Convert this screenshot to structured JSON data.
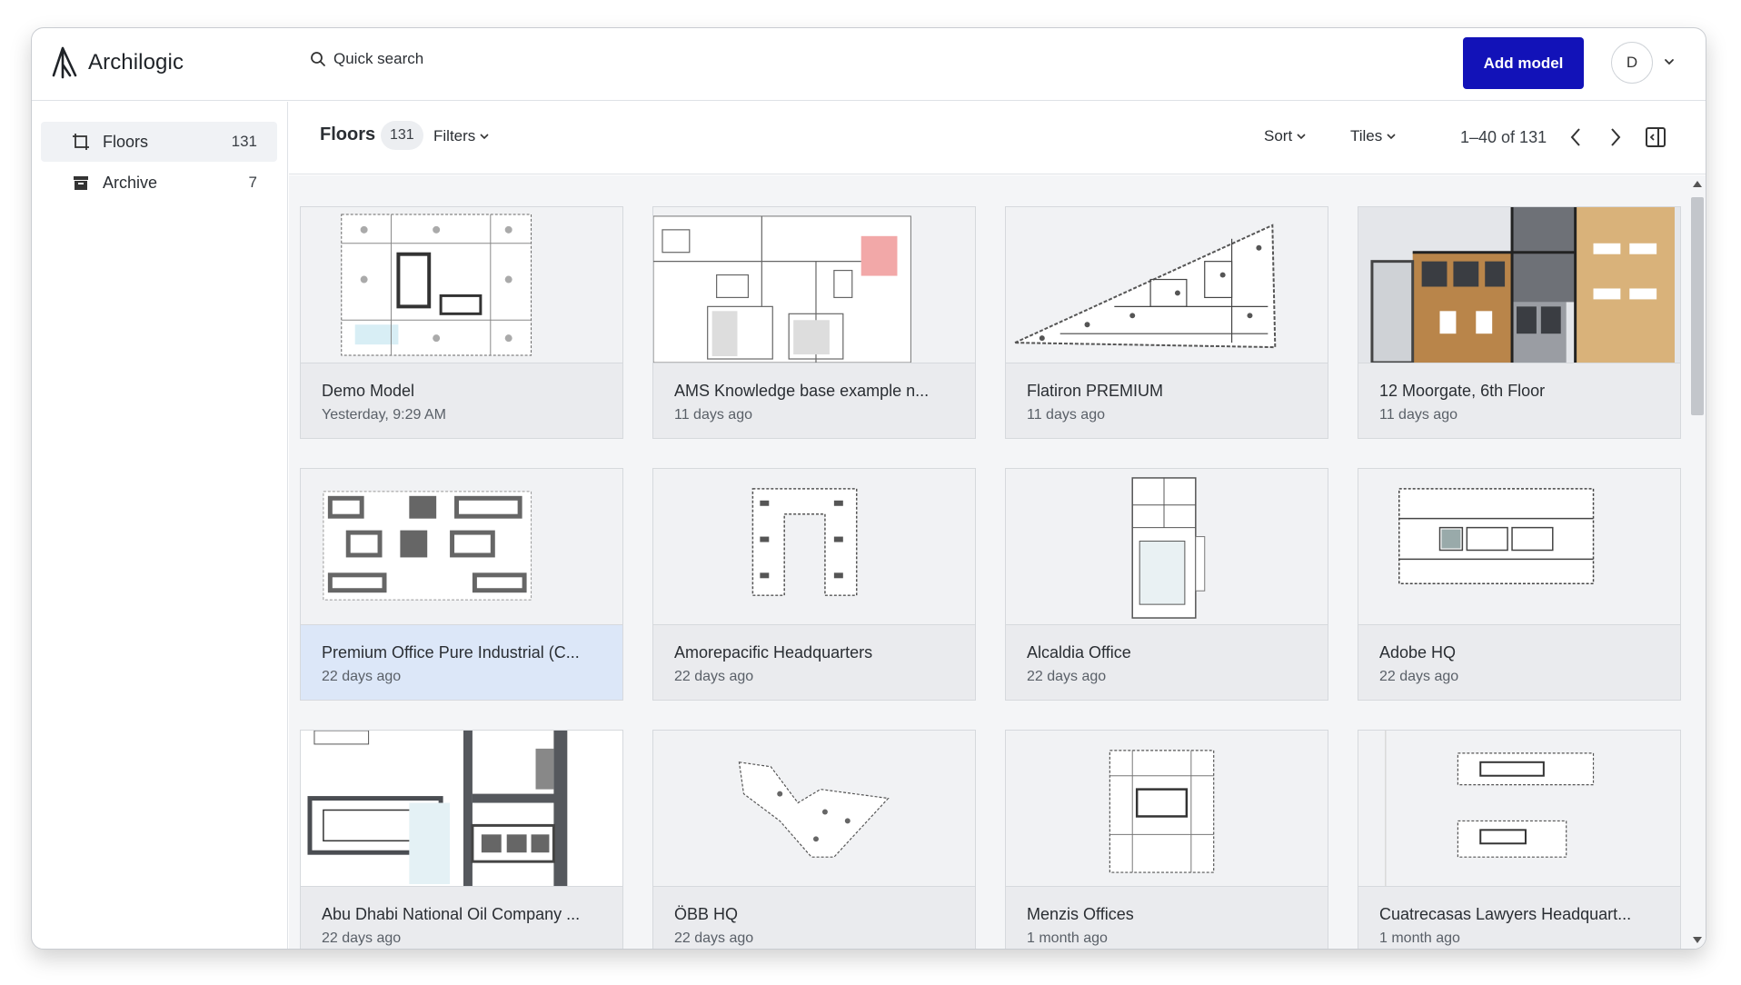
{
  "app": {
    "name": "Archilogic"
  },
  "search": {
    "placeholder": "Quick search"
  },
  "header": {
    "add_model_label": "Add model",
    "avatar_initial": "D"
  },
  "sidebar": {
    "items": [
      {
        "label": "Floors",
        "count": "131",
        "icon": "floor-icon",
        "active": true
      },
      {
        "label": "Archive",
        "count": "7",
        "icon": "archive-icon",
        "active": false
      }
    ]
  },
  "toolbar": {
    "title": "Floors",
    "count": "131",
    "filters_label": "Filters",
    "sort_label": "Sort",
    "view_label": "Tiles",
    "pagination": "1–40 of 131"
  },
  "cards": [
    {
      "title": "Demo Model",
      "date": "Yesterday, 9:29 AM",
      "selected": false
    },
    {
      "title": "AMS Knowledge base example n...",
      "date": "11 days ago",
      "selected": false
    },
    {
      "title": "Flatiron PREMIUM",
      "date": "11 days ago",
      "selected": false
    },
    {
      "title": "12 Moorgate, 6th Floor",
      "date": "11 days ago",
      "selected": false
    },
    {
      "title": "Premium Office Pure Industrial (C...",
      "date": "22 days ago",
      "selected": true
    },
    {
      "title": "Amorepacific Headquarters",
      "date": "22 days ago",
      "selected": false
    },
    {
      "title": "Alcaldia Office",
      "date": "22 days ago",
      "selected": false
    },
    {
      "title": "Adobe HQ",
      "date": "22 days ago",
      "selected": false
    },
    {
      "title": "Abu Dhabi National Oil Company ...",
      "date": "22 days ago",
      "selected": false
    },
    {
      "title": "ÖBB HQ",
      "date": "22 days ago",
      "selected": false
    },
    {
      "title": "Menzis Offices",
      "date": "1 month ago",
      "selected": false
    },
    {
      "title": "Cuatrecasas Lawyers Headquart...",
      "date": "1 month ago",
      "selected": false
    }
  ],
  "colors": {
    "accent": "#1212b8",
    "selected_card": "#dce7f8",
    "card_info": "#eaebee"
  }
}
